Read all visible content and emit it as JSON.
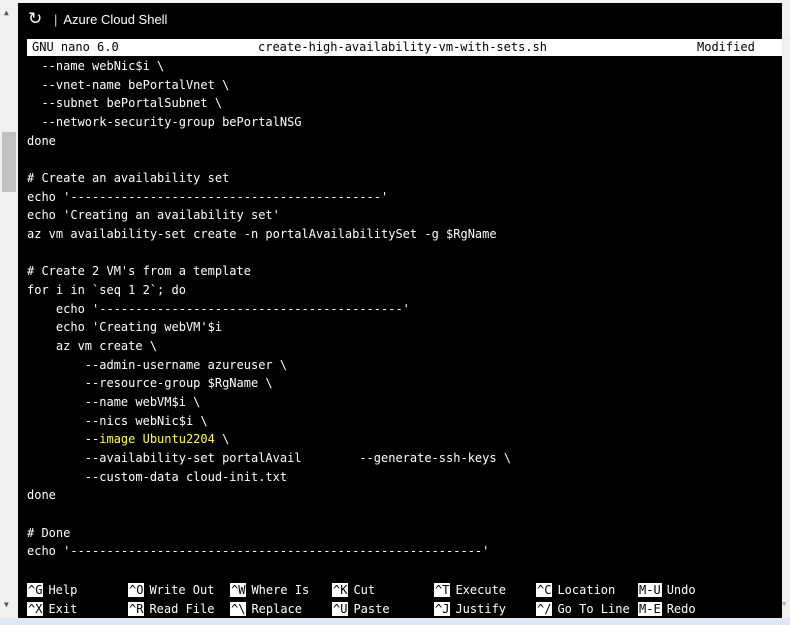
{
  "window": {
    "title": "Azure Cloud Shell",
    "refresh_icon": "refresh-icon"
  },
  "nano": {
    "version": "GNU nano 6.0",
    "filename": "create-high-availability-vm-with-sets.sh",
    "status": "Modified"
  },
  "code_lines": [
    "  --name webNic$i \\",
    "  --vnet-name bePortalVnet \\",
    "  --subnet bePortalSubnet \\",
    "  --network-security-group bePortalNSG",
    "done",
    "",
    "# Create an availability set",
    "echo '-------------------------------------------'",
    "echo 'Creating an availability set'",
    "az vm availability-set create -n portalAvailabilitySet -g $RgName",
    "",
    "# Create 2 VM's from a template",
    "for i in `seq 1 2`; do",
    "    echo '------------------------------------------'",
    "    echo 'Creating webVM'$i",
    "    az vm create \\",
    "        --admin-username azureuser \\",
    "        --resource-group $RgName \\",
    "        --name webVM$i \\",
    "        --nics webNic$i \\",
    "        --image Ubuntu2204 \\",
    "        --availability-set portalAvail        --generate-ssh-keys \\",
    "        --custom-data cloud-init.txt",
    "done",
    "",
    "# Done",
    "echo '---------------------------------------------------------'"
  ],
  "highlight": {
    "line_index": 20,
    "prefix": "        --",
    "highlighted": "image Ubuntu2204",
    "suffix": " \\",
    "color": "#ffff3c"
  },
  "shortcuts": [
    [
      {
        "key": "^G",
        "label": "Help"
      },
      {
        "key": "^O",
        "label": "Write Out"
      },
      {
        "key": "^W",
        "label": "Where Is"
      },
      {
        "key": "^K",
        "label": "Cut"
      },
      {
        "key": "^T",
        "label": "Execute"
      },
      {
        "key": "^C",
        "label": "Location"
      },
      {
        "key": "M-U",
        "label": "Undo"
      }
    ],
    [
      {
        "key": "^X",
        "label": "Exit"
      },
      {
        "key": "^R",
        "label": "Read File"
      },
      {
        "key": "^\\",
        "label": "Replace"
      },
      {
        "key": "^U",
        "label": "Paste"
      },
      {
        "key": "^J",
        "label": "Justify"
      },
      {
        "key": "^/",
        "label": "Go To Line"
      },
      {
        "key": "M-E",
        "label": "Redo"
      }
    ]
  ]
}
